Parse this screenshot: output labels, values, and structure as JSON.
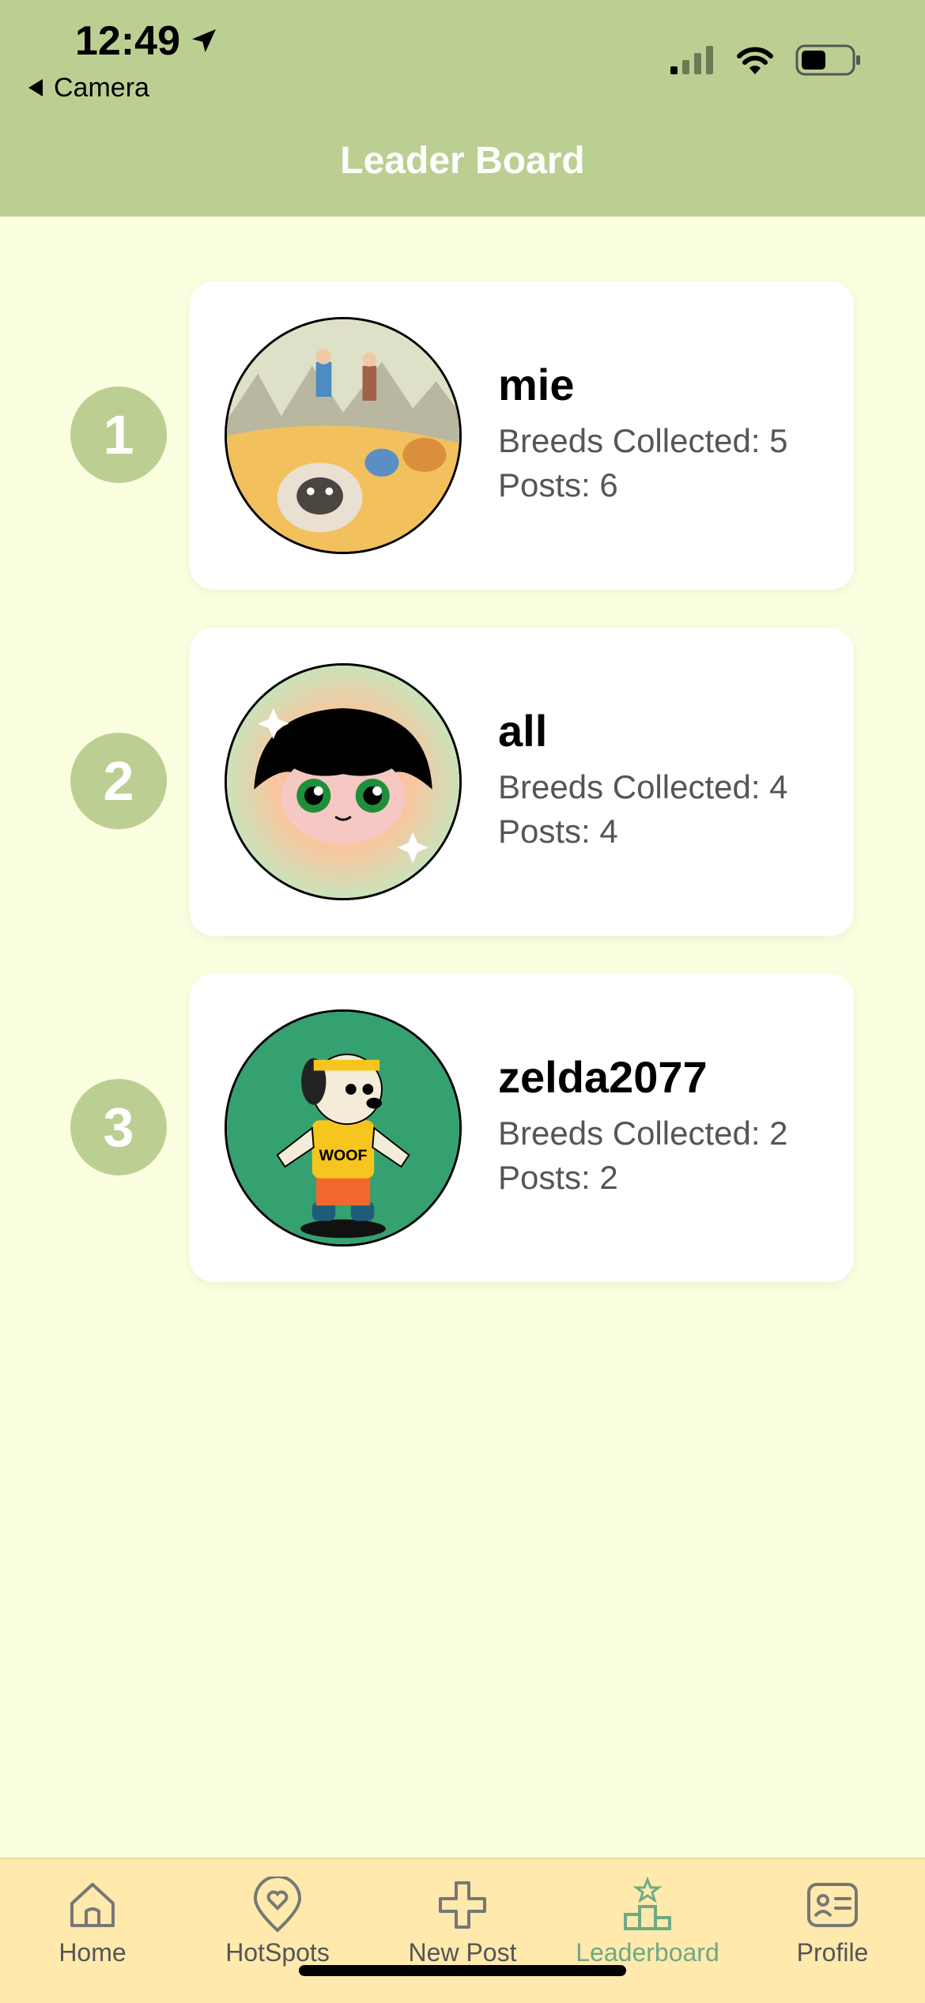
{
  "status_bar": {
    "time": "12:49",
    "back_app": "Camera"
  },
  "header": {
    "title": "Leader Board"
  },
  "leaders": [
    {
      "rank": "1",
      "name": "mie",
      "breeds": "Breeds Collected: 5",
      "posts": "Posts: 6"
    },
    {
      "rank": "2",
      "name": "all",
      "breeds": "Breeds Collected: 4",
      "posts": "Posts: 4"
    },
    {
      "rank": "3",
      "name": "zelda2077",
      "breeds": "Breeds Collected: 2",
      "posts": "Posts: 2"
    }
  ],
  "tabs": [
    {
      "label": "Home",
      "icon": "house-icon"
    },
    {
      "label": "HotSpots",
      "icon": "heart-pin-icon"
    },
    {
      "label": "New Post",
      "icon": "plus-icon"
    },
    {
      "label": "Leaderboard",
      "icon": "podium-icon",
      "active": true
    },
    {
      "label": "Profile",
      "icon": "id-card-icon"
    }
  ],
  "colors": {
    "header": "#bccf93",
    "background": "#fbffe0",
    "tabbar": "#ffe9ad",
    "active_tab": "#6eaa84"
  }
}
